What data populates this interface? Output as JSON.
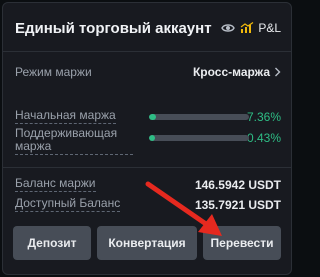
{
  "header": {
    "title": "Единый торговый аккаунт",
    "pl_label": "P&L"
  },
  "margin_mode": {
    "label": "Режим маржи",
    "value": "Кросс-маржа"
  },
  "initial_margin": {
    "label": "Начальная маржа",
    "value": "7.36%",
    "fill": 0.0736
  },
  "maintenance_margin": {
    "label": "Поддерживающая маржа",
    "value": "0.43%",
    "fill": 0.0043
  },
  "margin_balance": {
    "label": "Баланс маржи",
    "value": "146.5942 USDT"
  },
  "available_balance": {
    "label": "Доступный Баланс",
    "value": "135.7921 USDT"
  },
  "buttons": {
    "deposit": "Депозит",
    "convert": "Конвертация",
    "transfer": "Перевести"
  },
  "colors": {
    "accent_green": "#2ebd85",
    "pl_orange": "#f0b90b",
    "arrow_red": "#e6291f"
  }
}
